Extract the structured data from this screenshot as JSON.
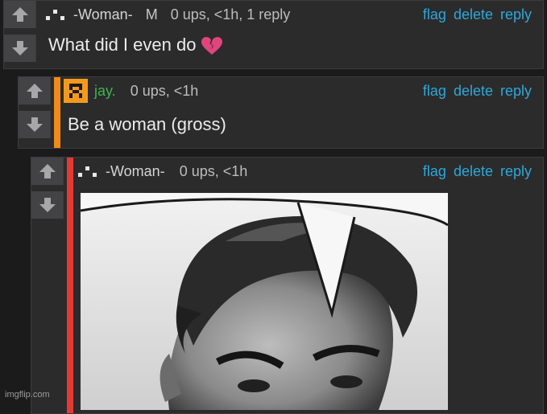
{
  "comments": [
    {
      "username": "-Woman-",
      "badge": "M",
      "meta": "0 ups, <1h, 1 reply",
      "text": "What did I even do",
      "emoji": "broken-heart-icon",
      "actions": [
        "flag",
        "delete",
        "reply"
      ]
    },
    {
      "username": "jay.",
      "meta": "0 ups, <1h",
      "text": "Be a woman (gross)",
      "username_color": "#3fb34f",
      "bar_color": "#f08a1a",
      "actions": [
        "flag",
        "delete",
        "reply"
      ]
    },
    {
      "username": "-Woman-",
      "meta": "0 ups, <1h",
      "bar_color": "#e53935",
      "actions": [
        "flag",
        "delete",
        "reply"
      ]
    }
  ],
  "watermark": "imgflip.com",
  "colors": {
    "link": "#2fa7d8",
    "background": "#1b1b1c",
    "panel": "#2b2b2c"
  },
  "image": {
    "description_icon": "meme-image"
  }
}
